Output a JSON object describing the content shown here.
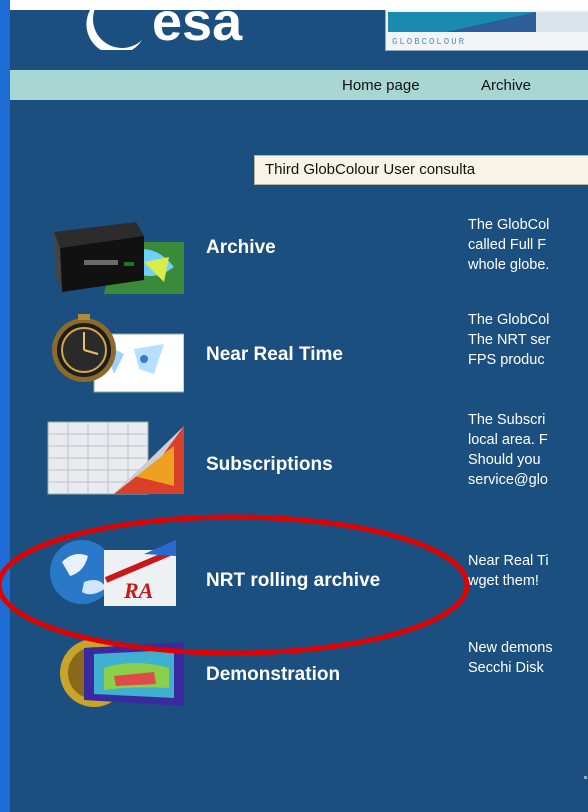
{
  "header": {
    "logo_text": "esa",
    "banner_text": "GLOBCOLOUR"
  },
  "nav": {
    "items": [
      "Home page",
      "Archive"
    ]
  },
  "notice": {
    "text": "Third GlobColour User consulta"
  },
  "rows": [
    {
      "title": "Archive",
      "desc": [
        "The GlobCol",
        "called Full F",
        "whole globe."
      ]
    },
    {
      "title": "Near Real Time",
      "desc": [
        "The GlobCol",
        "The NRT ser",
        "FPS produc"
      ]
    },
    {
      "title": "Subscriptions",
      "desc": [
        "The Subscri",
        "local area. F",
        "Should you",
        "service@glo"
      ]
    },
    {
      "title": "NRT rolling archive",
      "desc": [
        "Near Real Ti",
        "wget them!"
      ]
    },
    {
      "title": "Demonstration",
      "desc": [
        "New demons",
        "Secchi Disk"
      ]
    }
  ],
  "highlight": {
    "color": "#e00000"
  },
  "colors": {
    "page_background": "#1b4f80",
    "nav_background": "#a8d6d2",
    "left_bar": "#1d6cd4"
  }
}
